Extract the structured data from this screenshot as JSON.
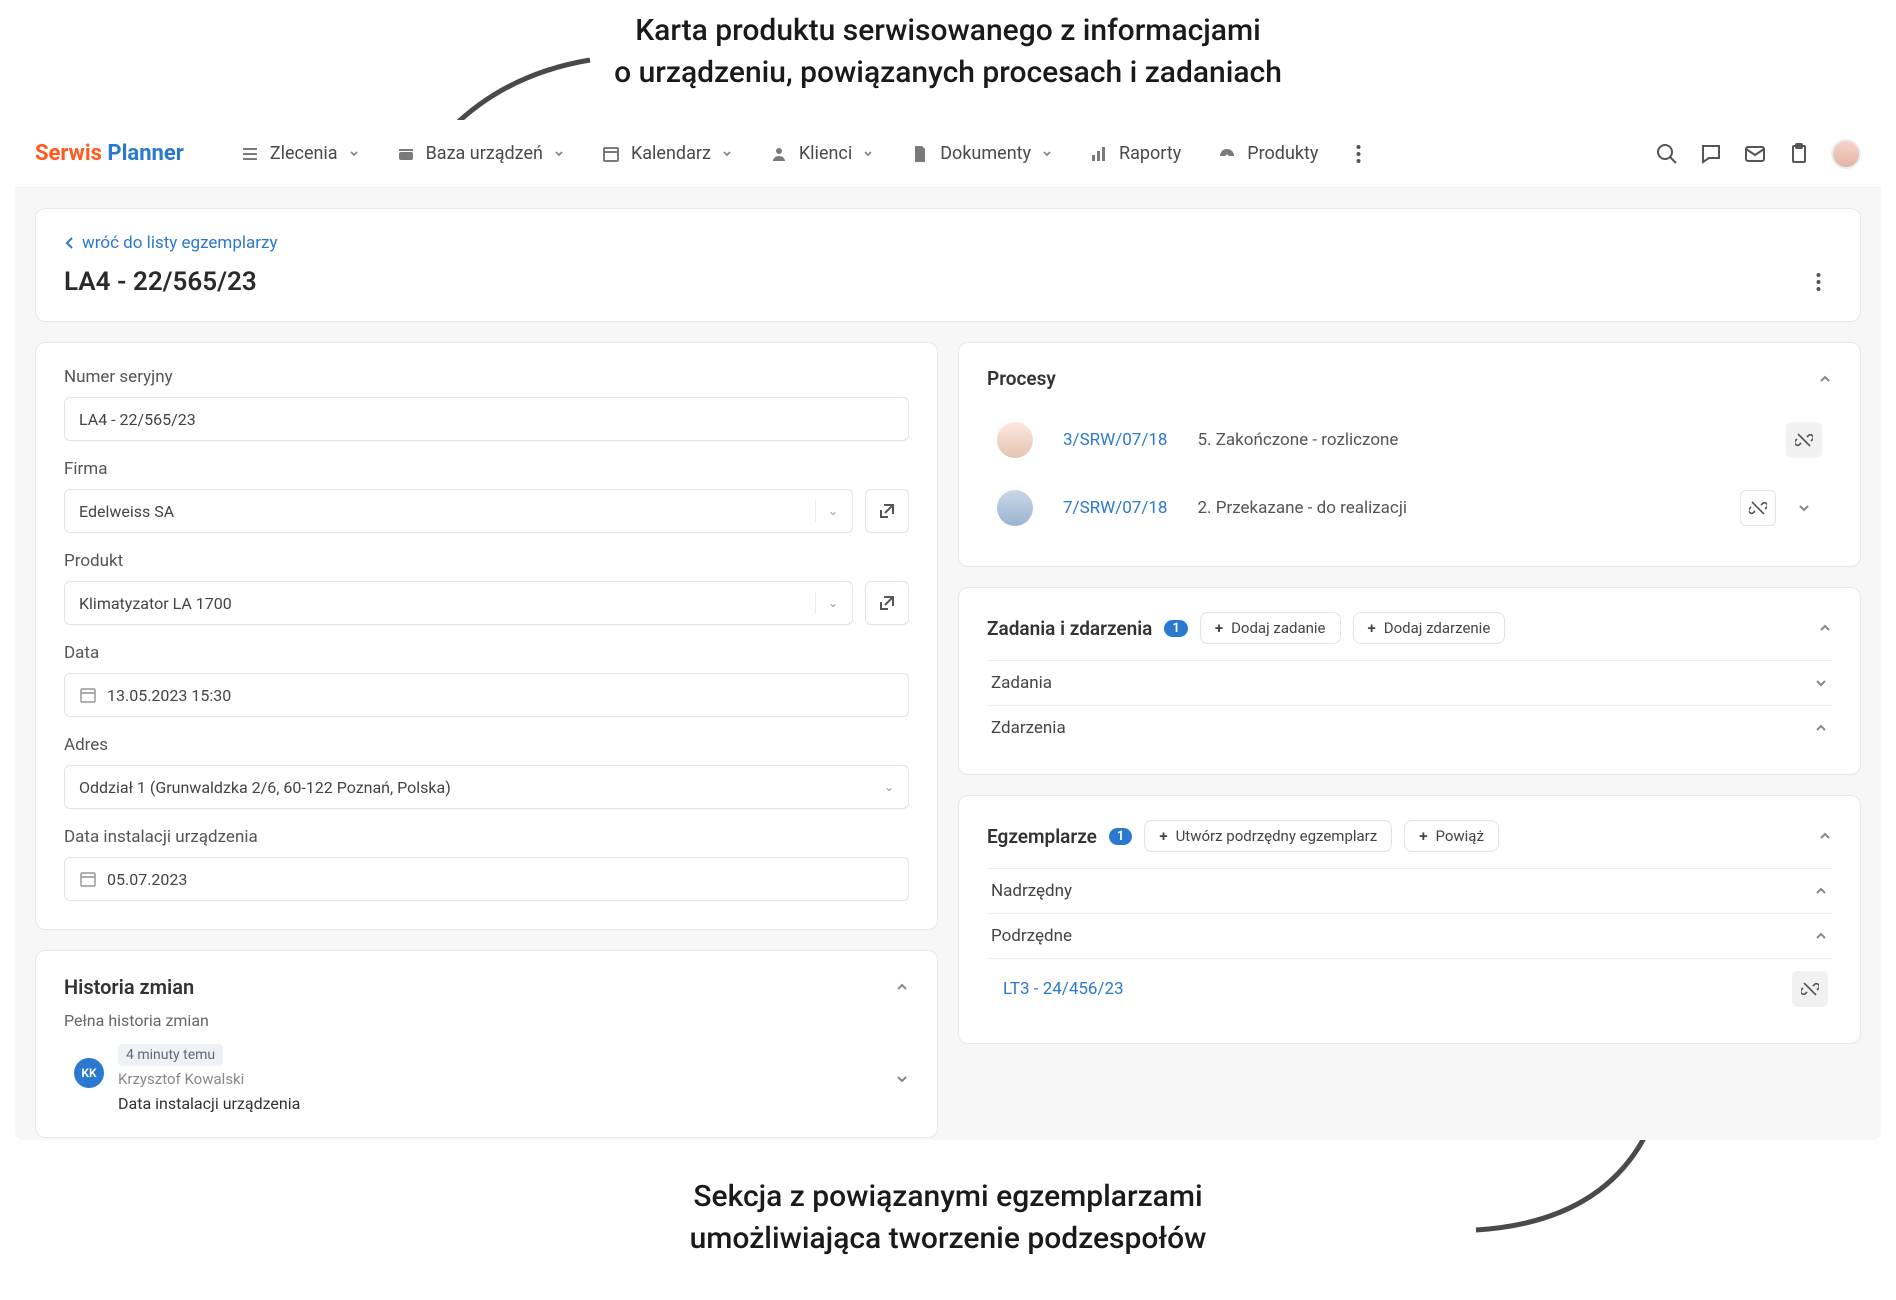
{
  "annotations": {
    "top": "Karta produktu serwisowanego z informacjami\no urządzeniu, powiązanych procesach i zadaniach",
    "bottom": "Sekcja z powiązanymi egzemplarzami\numożliwiająca tworzenie podzespołów"
  },
  "brand": {
    "part1": "Serwis",
    "part2": "Planner"
  },
  "nav": [
    {
      "label": "Zlecenia",
      "icon": "list-icon",
      "dropdown": true
    },
    {
      "label": "Baza urządzeń",
      "icon": "device-icon",
      "dropdown": true
    },
    {
      "label": "Kalendarz",
      "icon": "calendar-icon",
      "dropdown": true
    },
    {
      "label": "Klienci",
      "icon": "person-icon",
      "dropdown": true
    },
    {
      "label": "Dokumenty",
      "icon": "document-icon",
      "dropdown": true
    },
    {
      "label": "Raporty",
      "icon": "chart-icon",
      "dropdown": false
    },
    {
      "label": "Produkty",
      "icon": "dashboard-icon",
      "dropdown": false
    }
  ],
  "header": {
    "back": "wróć do listy egzemplarzy",
    "title": "LA4 - 22/565/23"
  },
  "form": {
    "serial_label": "Numer seryjny",
    "serial_value": "LA4 - 22/565/23",
    "company_label": "Firma",
    "company_value": "Edelweiss SA",
    "product_label": "Produkt",
    "product_value": "Klimatyzator LA 1700",
    "date_label": "Data",
    "date_value": "13.05.2023 15:30",
    "address_label": "Adres",
    "address_value": "Oddział 1 (Grunwaldzka 2/6, 60-122 Poznań, Polska)",
    "install_label": "Data instalacji urządzenia",
    "install_value": "05.07.2023"
  },
  "history": {
    "title": "Historia zmian",
    "subtitle": "Pełna historia zmian",
    "item": {
      "tag": "4 minuty temu",
      "initials": "KK",
      "author": "Krzysztof Kowalski",
      "field": "Data instalacji urządzenia"
    }
  },
  "processes": {
    "title": "Procesy",
    "rows": [
      {
        "id": "3/SRW/07/18",
        "status": "5. Zakończone - rozliczone"
      },
      {
        "id": "7/SRW/07/18",
        "status": "2. Przekazane - do realizacji"
      }
    ]
  },
  "tasks": {
    "title": "Zadania i zdarzenia",
    "badge": "1",
    "add_task": "Dodaj zadanie",
    "add_event": "Dodaj zdarzenie",
    "tasks_label": "Zadania",
    "events_label": "Zdarzenia"
  },
  "samples": {
    "title": "Egzemplarze",
    "badge": "1",
    "create_sub": "Utwórz podrzędny egzemplarz",
    "link": "Powiąż",
    "parent_label": "Nadrzędny",
    "child_label": "Podrzędne",
    "child_item": "LT3 - 24/456/23"
  }
}
